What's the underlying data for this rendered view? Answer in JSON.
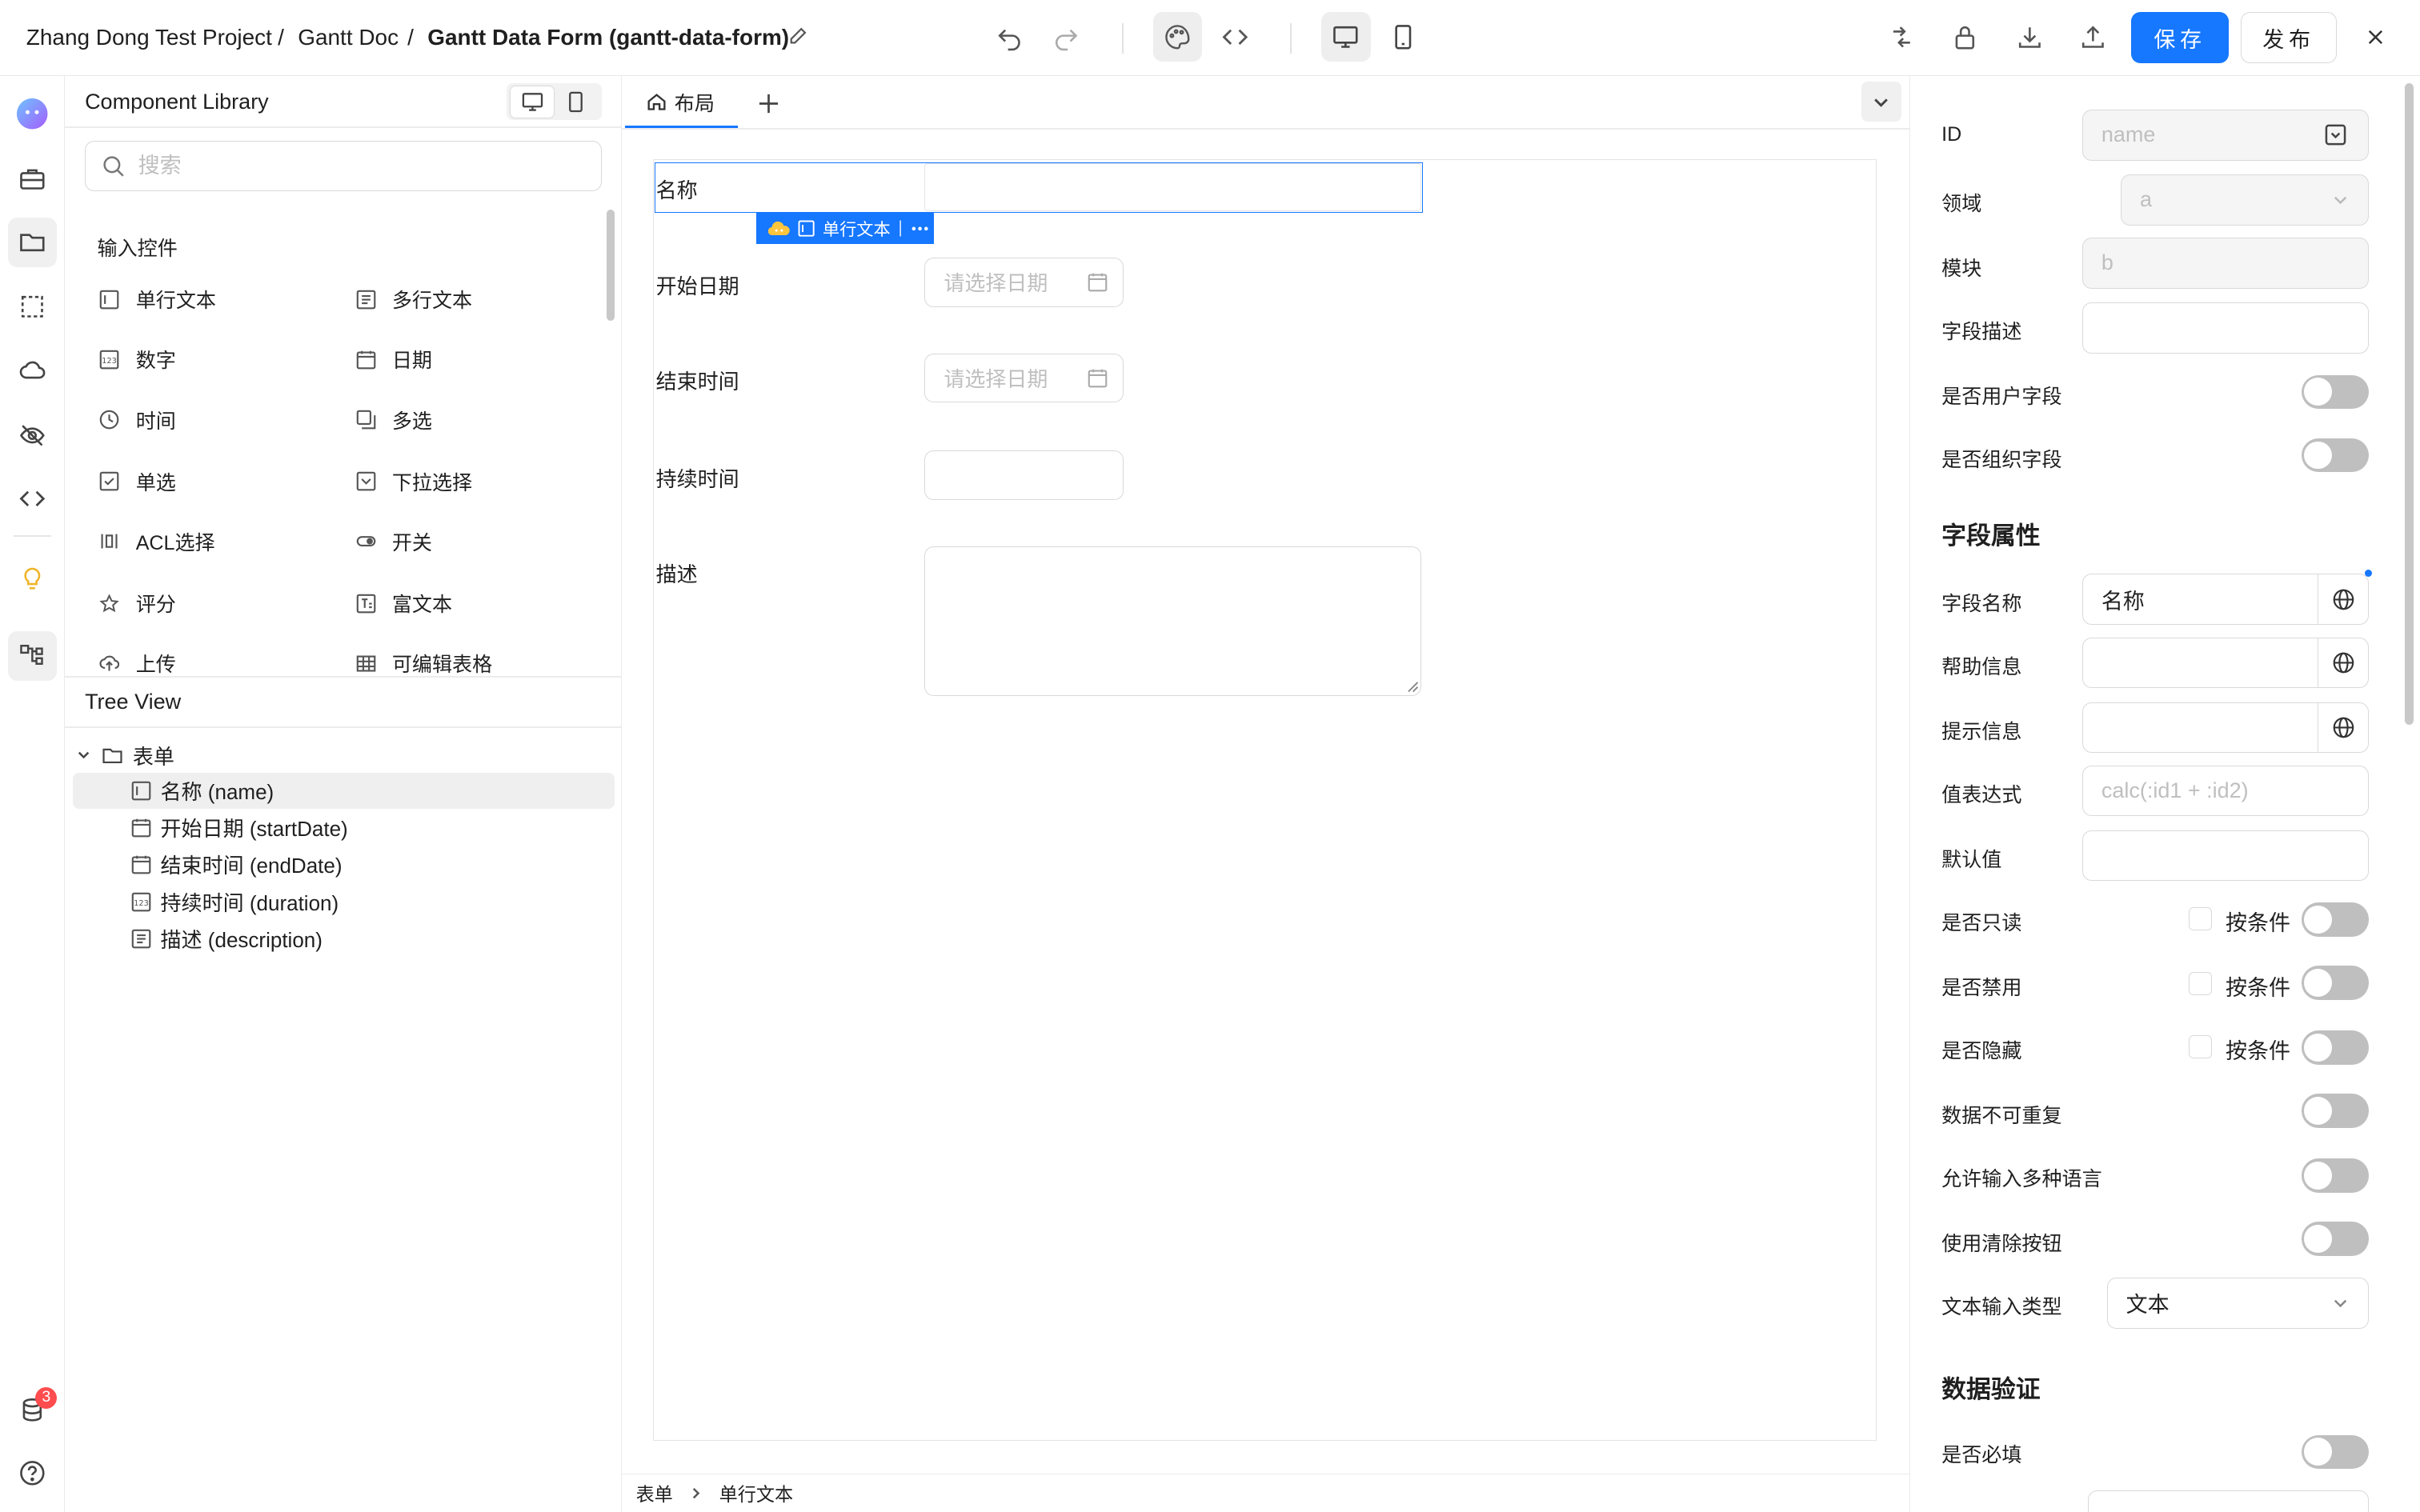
{
  "breadcrumb": {
    "project": "Zhang Dong Test Project",
    "sep1": "/",
    "doc": "Gantt Doc",
    "sep2": "/",
    "form": "Gantt Data Form (gantt-data-form)"
  },
  "toolbar": {
    "save_label": "保存",
    "publish_label": "发布"
  },
  "rail": {
    "badge_count": "3"
  },
  "left_panel": {
    "title": "Component Library",
    "search_placeholder": "搜索",
    "section_label": "输入控件",
    "components": [
      {
        "label": "单行文本",
        "icon": "single-line-text-icon"
      },
      {
        "label": "多行文本",
        "icon": "multi-line-text-icon"
      },
      {
        "label": "数字",
        "icon": "number-icon"
      },
      {
        "label": "日期",
        "icon": "calendar-icon"
      },
      {
        "label": "时间",
        "icon": "clock-icon"
      },
      {
        "label": "多选",
        "icon": "multi-select-icon"
      },
      {
        "label": "单选",
        "icon": "checkbox-icon"
      },
      {
        "label": "下拉选择",
        "icon": "dropdown-icon"
      },
      {
        "label": "ACL选择",
        "icon": "acl-icon"
      },
      {
        "label": "开关",
        "icon": "switch-icon"
      },
      {
        "label": "评分",
        "icon": "star-icon"
      },
      {
        "label": "富文本",
        "icon": "rich-text-icon"
      },
      {
        "label": "上传",
        "icon": "upload-icon"
      },
      {
        "label": "可编辑表格",
        "icon": "table-icon"
      }
    ],
    "tree_title": "Tree View",
    "tree_root": "表单",
    "tree_items": [
      {
        "label": "名称 (name)",
        "icon": "text-field-icon"
      },
      {
        "label": "开始日期 (startDate)",
        "icon": "calendar-icon"
      },
      {
        "label": "结束时间 (endDate)",
        "icon": "calendar-icon"
      },
      {
        "label": "持续时间 (duration)",
        "icon": "number-icon"
      },
      {
        "label": "描述 (description)",
        "icon": "multi-line-text-icon"
      }
    ]
  },
  "canvas": {
    "tab_label": "布局",
    "fields": {
      "name_label": "名称",
      "start_label": "开始日期",
      "start_placeholder": "请选择日期",
      "end_label": "结束时间",
      "end_placeholder": "请选择日期",
      "duration_label": "持续时间",
      "desc_label": "描述"
    },
    "selection_tag": "单行文本",
    "status_crumb": [
      "表单",
      "单行文本"
    ]
  },
  "right_panel": {
    "id_label": "ID",
    "id_value": "name",
    "domain_label": "领域",
    "domain_value": "a",
    "module_label": "模块",
    "module_value": "b",
    "field_desc_label": "字段描述",
    "is_user_field_label": "是否用户字段",
    "is_org_field_label": "是否组织字段",
    "field_props_heading": "字段属性",
    "field_name_label": "字段名称",
    "field_name_value": "名称",
    "help_label": "帮助信息",
    "hint_label": "提示信息",
    "expr_label": "值表达式",
    "expr_placeholder": "calc(:id1 + :id2)",
    "default_label": "默认值",
    "readonly_label": "是否只读",
    "disabled_label": "是否禁用",
    "hidden_label": "是否隐藏",
    "conditional_label": "按条件",
    "unique_label": "数据不可重复",
    "multilang_label": "允许输入多种语言",
    "clear_btn_label": "使用清除按钮",
    "text_type_label": "文本输入类型",
    "text_type_value": "文本",
    "validation_heading": "数据验证",
    "required_label": "是否必填"
  },
  "colors": {
    "primary": "#1677ff",
    "badge": "#ff4d4f",
    "toggle_off": "#bfbfbf"
  }
}
